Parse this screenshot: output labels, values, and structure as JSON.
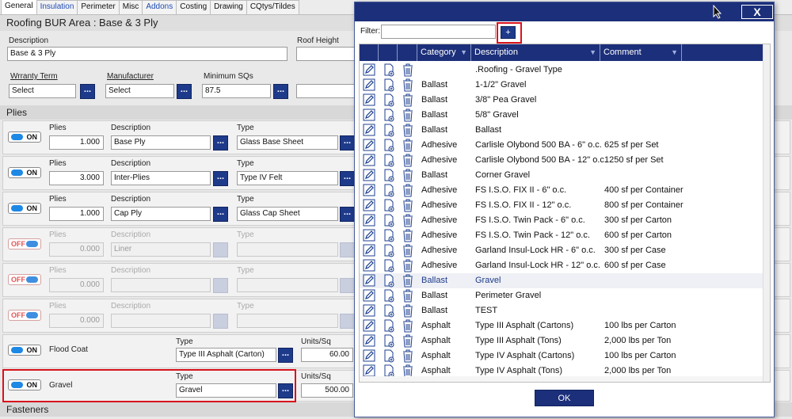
{
  "tabs": [
    {
      "label": "General"
    },
    {
      "label": "Insulation"
    },
    {
      "label": "Perimeter"
    },
    {
      "label": "Misc"
    },
    {
      "label": "Addons"
    },
    {
      "label": "Costing"
    },
    {
      "label": "Drawing"
    },
    {
      "label": "CQtys/Tildes"
    }
  ],
  "area_title": "Roofing BUR Area : Base & 3 Ply",
  "general": {
    "description_label": "Description",
    "description_value": "Base & 3 Ply",
    "roof_height_label": "Roof Height",
    "warranty_label": "Wrranty Term",
    "warranty_value": "Select",
    "manufacturer_label": "Manufacturer",
    "manufacturer_value": "Select",
    "min_sq_label": "Minimum SQs",
    "min_sq_value": "87.5",
    "dots": "..."
  },
  "plies_section": "Plies",
  "plies": [
    {
      "state": "ON",
      "plies_label": "Plies",
      "plies": "1.000",
      "desc_label": "Description",
      "desc": "Base Ply",
      "type_label": "Type",
      "type": "Glass Base Sheet"
    },
    {
      "state": "ON",
      "plies_label": "Plies",
      "plies": "3.000",
      "desc_label": "Description",
      "desc": "Inter-Plies",
      "type_label": "Type",
      "type": "Type IV Felt"
    },
    {
      "state": "ON",
      "plies_label": "Plies",
      "plies": "1.000",
      "desc_label": "Description",
      "desc": "Cap Ply",
      "type_label": "Type",
      "type": "Glass Cap Sheet"
    },
    {
      "state": "OFF",
      "plies_label": "Plies",
      "plies": "0.000",
      "desc_label": "Description",
      "desc": "Liner",
      "type_label": "Type",
      "type": ""
    },
    {
      "state": "OFF",
      "plies_label": "Plies",
      "plies": "0.000",
      "desc_label": "Description",
      "desc": "",
      "type_label": "Type",
      "type": ""
    },
    {
      "state": "OFF",
      "plies_label": "Plies",
      "plies": "0.000",
      "desc_label": "Description",
      "desc": "",
      "type_label": "Type",
      "type": ""
    }
  ],
  "flood_coat": {
    "state": "ON",
    "label": "Flood Coat",
    "type_label": "Type",
    "type": "Type III Asphalt (Carton)",
    "units_label": "Units/Sq",
    "units": "60.00"
  },
  "gravel": {
    "state": "ON",
    "label": "Gravel",
    "type_label": "Type",
    "type": "Gravel",
    "units_label": "Units/Sq",
    "units": "500.00"
  },
  "fasteners_section": "Fasteners",
  "dialog": {
    "close": "X",
    "filter_label": "Filter:",
    "filter_value": "",
    "add": "+",
    "headers": {
      "category": "Category",
      "description": "Description",
      "comment": "Comment"
    },
    "rows": [
      {
        "category": "",
        "description": ".Roofing - Gravel Type",
        "comment": ""
      },
      {
        "category": "Ballast",
        "description": "1-1/2\" Gravel",
        "comment": ""
      },
      {
        "category": "Ballast",
        "description": "3/8\" Pea Gravel",
        "comment": ""
      },
      {
        "category": "Ballast",
        "description": "5/8\" Gravel",
        "comment": ""
      },
      {
        "category": "Ballast",
        "description": "Ballast",
        "comment": ""
      },
      {
        "category": "Adhesive",
        "description": "Carlisle Olybond 500 BA - 6\" o.c.",
        "comment": "625 sf per Set"
      },
      {
        "category": "Adhesive",
        "description": "Carlisle Olybond 500 BA - 12\" o.c.",
        "comment": "1250 sf per Set"
      },
      {
        "category": "Ballast",
        "description": "Corner Gravel",
        "comment": ""
      },
      {
        "category": "Adhesive",
        "description": "FS I.S.O. FIX II - 6\" o.c.",
        "comment": "400 sf per Container"
      },
      {
        "category": "Adhesive",
        "description": "FS I.S.O. FIX II - 12\" o.c.",
        "comment": "800 sf per Container"
      },
      {
        "category": "Adhesive",
        "description": "FS I.S.O. Twin Pack - 6\" o.c.",
        "comment": "300 sf per Carton"
      },
      {
        "category": "Adhesive",
        "description": "FS I.S.O. Twin Pack - 12\" o.c.",
        "comment": "600 sf per Carton"
      },
      {
        "category": "Adhesive",
        "description": "Garland Insul-Lock HR - 6\" o.c.",
        "comment": "300 sf per Case"
      },
      {
        "category": "Adhesive",
        "description": "Garland Insul-Lock HR - 12\" o.c.",
        "comment": "600 sf per Case"
      },
      {
        "category": "Ballast",
        "description": "Gravel",
        "comment": ""
      },
      {
        "category": "Ballast",
        "description": "Perimeter Gravel",
        "comment": ""
      },
      {
        "category": "Ballast",
        "description": "TEST",
        "comment": ""
      },
      {
        "category": "Asphalt",
        "description": "Type III Asphalt (Cartons)",
        "comment": "100 lbs per Carton"
      },
      {
        "category": "Asphalt",
        "description": "Type III Asphalt (Tons)",
        "comment": "2,000 lbs per Ton"
      },
      {
        "category": "Asphalt",
        "description": "Type IV Asphalt (Cartons)",
        "comment": "100 lbs per Carton"
      },
      {
        "category": "Asphalt",
        "description": "Type IV Asphalt (Tons)",
        "comment": "2,000 lbs per Ton"
      }
    ],
    "selected_index": 14,
    "ok": "OK"
  }
}
